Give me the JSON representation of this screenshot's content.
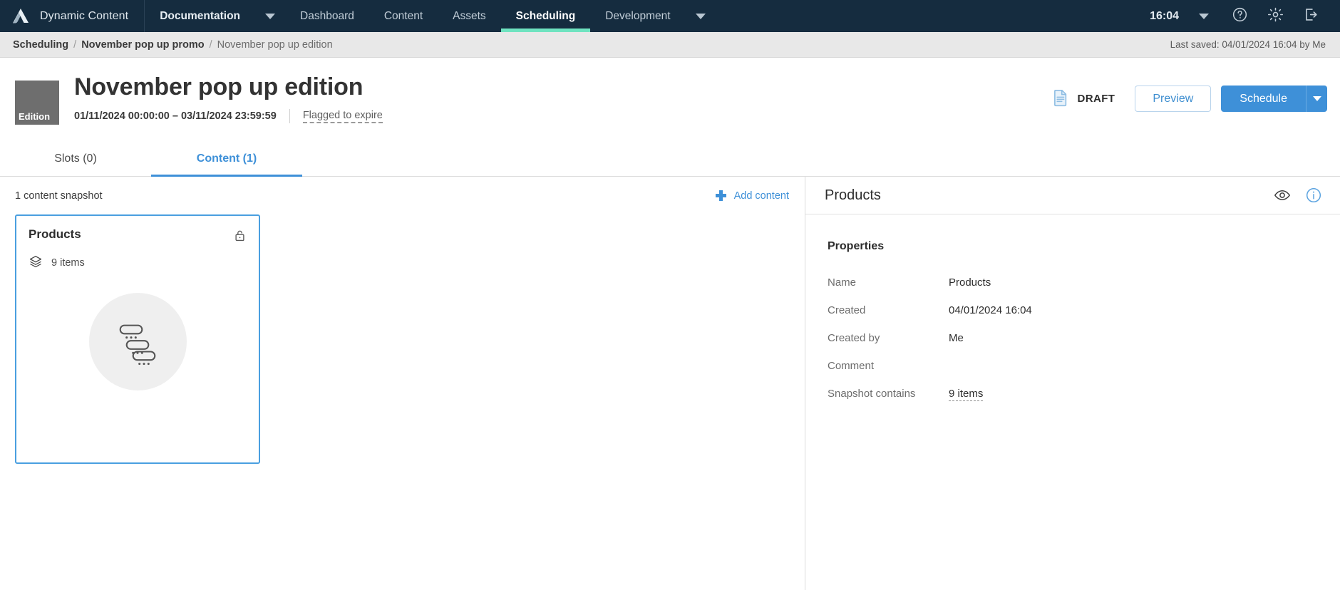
{
  "topnav": {
    "logo_icon": "amplience-logo-icon",
    "brand": "Dynamic Content",
    "items": [
      {
        "label": "Documentation",
        "icon": "",
        "bold": true,
        "active": false,
        "has_caret": true
      },
      {
        "label": "Dashboard",
        "bold": false,
        "active": false,
        "has_caret": false
      },
      {
        "label": "Content",
        "bold": false,
        "active": false,
        "has_caret": false
      },
      {
        "label": "Assets",
        "bold": false,
        "active": false,
        "has_caret": false
      },
      {
        "label": "Scheduling",
        "bold": false,
        "active": true,
        "has_caret": false
      },
      {
        "label": "Development",
        "bold": false,
        "active": false,
        "has_caret": true
      }
    ],
    "clock": "16:04",
    "clock_caret_icon": "chevron-down-icon",
    "help_icon": "help-circle-icon",
    "settings_icon": "gear-icon",
    "logout_icon": "logout-icon",
    "active_underline_color": "#6fe3c0",
    "background_color": "#152c3f"
  },
  "breadcrumb": {
    "items": [
      "Scheduling",
      "November pop up promo",
      "November pop up edition"
    ],
    "separator": "/",
    "last_saved": "Last saved: 04/01/2024 16:04 by Me"
  },
  "title_area": {
    "badge_label": "Edition",
    "badge_color": "#6e6e6e",
    "title": "November pop up edition",
    "date_range": "01/11/2024 00:00:00 – 03/11/2024 23:59:59",
    "flagged_label": "Flagged to expire",
    "status_icon": "document-draft-icon",
    "status_label": "DRAFT",
    "preview_label": "Preview",
    "schedule_label": "Schedule",
    "schedule_caret_icon": "chevron-down-icon",
    "primary_color": "#3e90d8"
  },
  "tabs": [
    {
      "label": "Slots (0)",
      "active": false
    },
    {
      "label": "Content (1)",
      "active": true
    }
  ],
  "left_pane": {
    "snapshot_count": "1 content snapshot",
    "add_content_label": "Add content",
    "add_icon": "plus-icon",
    "card": {
      "title": "Products",
      "lock_icon": "unlocked-padlock-icon",
      "items_icon": "layers-icon",
      "items_label": "9 items",
      "thumb_icon": "content-slots-placeholder-icon"
    }
  },
  "right_pane": {
    "title": "Products",
    "eye_icon": "eye-icon",
    "info_icon": "info-circle-icon",
    "properties_title": "Properties",
    "properties": [
      {
        "label": "Name",
        "value": "Products",
        "dashed": false
      },
      {
        "label": "Created",
        "value": "04/01/2024 16:04",
        "dashed": false
      },
      {
        "label": "Created by",
        "value": "Me",
        "dashed": false
      },
      {
        "label": "Comment",
        "value": "",
        "dashed": false
      },
      {
        "label": "Snapshot contains",
        "value": "9 items",
        "dashed": true
      }
    ]
  }
}
